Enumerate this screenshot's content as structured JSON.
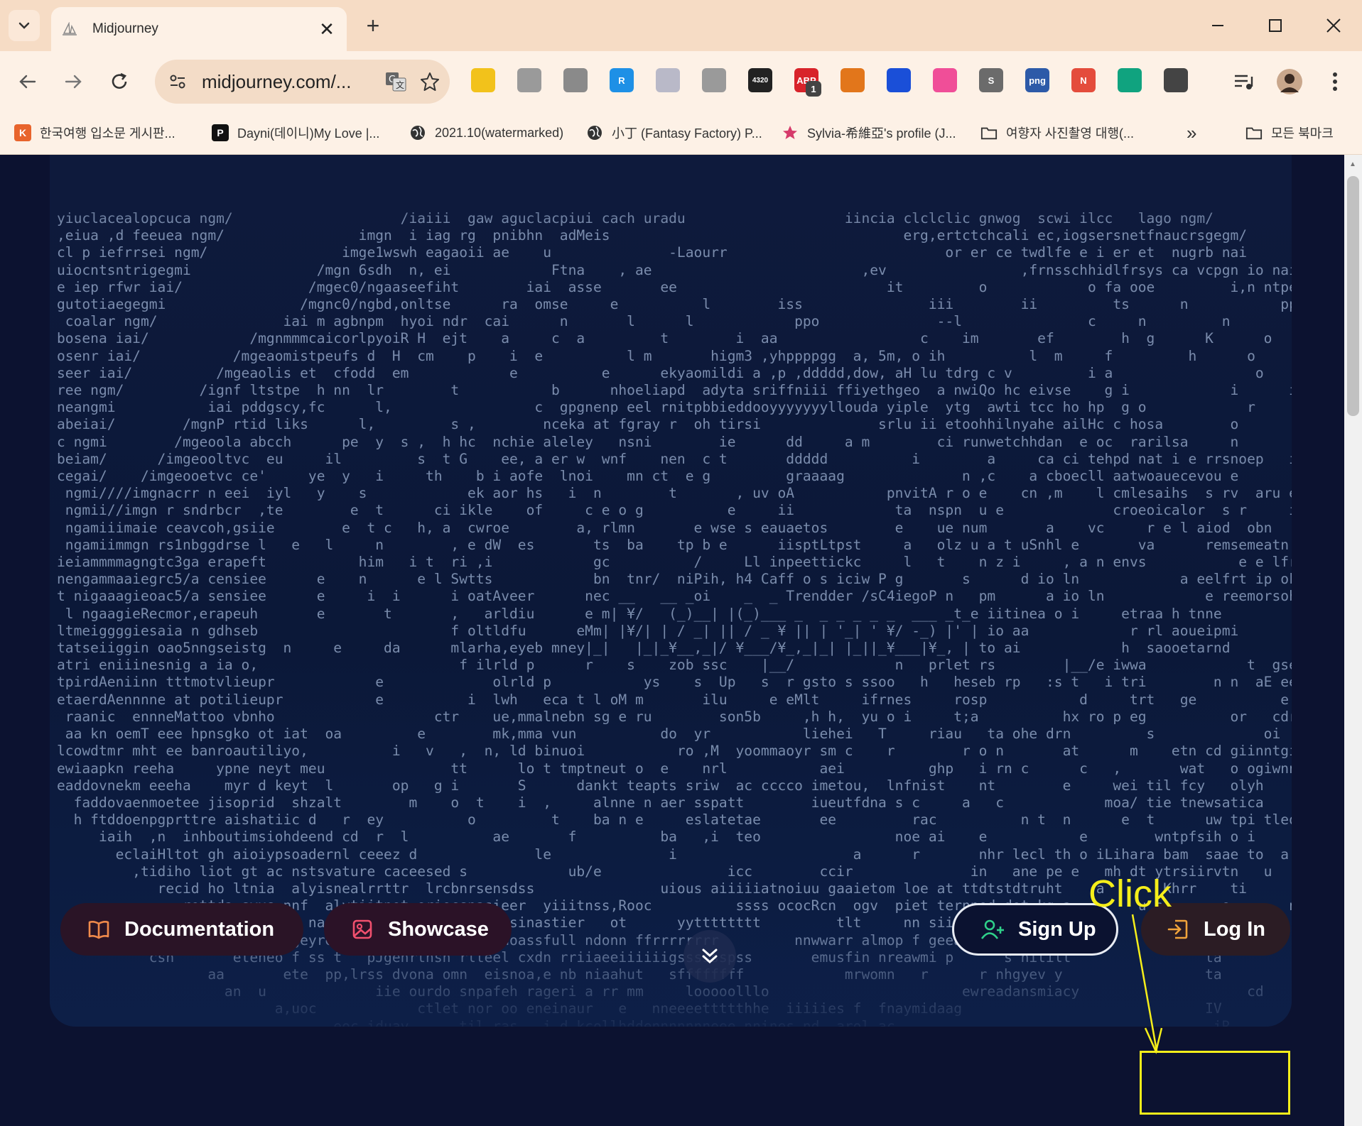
{
  "browser": {
    "tab_title": "Midjourney",
    "tab_close": "✕",
    "new_tab": "+",
    "url": "midjourney.com/...",
    "bookmarks": [
      {
        "label": "한국여행 입소문 게시판...",
        "icon": "K",
        "color": "#e8642c"
      },
      {
        "label": "Dayni(데이니)My Love |...",
        "icon": "P",
        "color": "#111111"
      },
      {
        "label": "2021.10(watermarked)",
        "icon": "globe",
        "color": "#333333"
      },
      {
        "label": "小丁 (Fantasy Factory) P...",
        "icon": "globe",
        "color": "#333333"
      },
      {
        "label": "Sylvia-希維亞's profile (J...",
        "icon": "star",
        "color": "#d63a6a"
      },
      {
        "label": "여향자 사진촬영 대행(...",
        "icon": "folder",
        "color": "#333333"
      }
    ],
    "bookmarks_overflow": "»",
    "all_bookmarks": "모든 북마크",
    "extensions": [
      {
        "name": "yellow-ext-icon",
        "color": "#f2c21b",
        "text": ""
      },
      {
        "name": "camera-ext-icon",
        "color": "#9a9a9a",
        "text": ""
      },
      {
        "name": "download-ext-icon",
        "color": "#8a8a8a",
        "text": ""
      },
      {
        "name": "r-ext-icon",
        "color": "#1e90e6",
        "text": "R"
      },
      {
        "name": "circles-ext-icon",
        "color": "#b9b9c8",
        "text": ""
      },
      {
        "name": "mouse-ext-icon",
        "color": "#9a9a9a",
        "text": ""
      },
      {
        "name": "4320-ext-icon",
        "color": "#222222",
        "text": "4320"
      },
      {
        "name": "abp-ext-icon",
        "color": "#d8232a",
        "text": "ABP"
      },
      {
        "name": "fox-ext-icon",
        "color": "#e2761b",
        "text": ""
      },
      {
        "name": "arrow-down-ext-icon",
        "color": "#1a4fd8",
        "text": ""
      },
      {
        "name": "ring-ext-icon",
        "color": "#f04e98",
        "text": ""
      },
      {
        "name": "s-ext-icon",
        "color": "#6b6b6b",
        "text": "S"
      },
      {
        "name": "png-ext-icon",
        "color": "#2d5aa8",
        "text": "png"
      },
      {
        "name": "n-ext-icon",
        "color": "#e44c3c",
        "text": "N"
      },
      {
        "name": "gpt-ext-icon",
        "color": "#10a37f",
        "text": ""
      },
      {
        "name": "puzzle-ext-icon",
        "color": "#444444",
        "text": ""
      }
    ],
    "abp_badge": "1"
  },
  "page": {
    "ascii_lines": [
      "yiuclacealopcuca ngm/                    /iaiii  gaw aguclacpiui cach uradu                   iincia clclclic gnwog  scwi ilcc   lago ngm/",
      ",eiua ,d feeuea ngm/                imgn  i iag rg  pnibhn  adMeis                                   erg,ertctchcali ec,iogsersnetfnaucrsgegm/",
      "cl p iefrrsei ngm/                imge1wswh eagaoii ae    u              -Laourr                          or er ce twdlfe e i er et  nugrb nai",
      "uiocntsntrigegmi               /mgn 6sdh  n, ei            Ftna    , ae                         ,ev                ,frnsschhidlfrsys ca vcpgn io nai",
      "e iep rfwr iai/               /mgec0/ngaaseefiht        iai  asse       ee                         it         o            o fa ooe         i,n ntpeniioeim/",
      "gutotiaegegmi                /mgnc0/ngbd,onltse      ra  omse     e          l        iss               iii        ii         ts      n           ppsa o           aaocspneoln",
      " coalar ngm/               iai m agbnpm  hyoi ndr  cai      n       l      l            ppo              --l               c     n         n           eotlr                ywelg",
      "bosena iai/            /mgnmmmcaicorlpyoiR H  ejt    a     c  a         t        i  aa                 c    im       ef        h  g      K      o         ne tl                   w",
      "osenr iai/           /mgeaomistpeufs d  H  cm    p    i  e          l m       higm3 ,yhppppgg  a, 5m, o ih          l  m     f         h      o      h        ho c",
      "seer iai/          /mgeaolis et  cfodd  em            e          e      ekyaomildi a ,p ,ddddd,dow, aH lu tdrg c v         i a                 o    r       en",
      "ree ngm/         /ignf ltstpe  h nn  lr        t           b      nhoeliapd  adyta sriffniii ffiyethgeo  a nwiQo hc eivse    g i            i      i     i      e",
      "neangmi           iai pddgscy,fc      l,                 c  gpgnenp eel rnitpbbieddooyyyyyyylloudа yiple  ytg  awti tcc ho hp  g o            r     i     i       st",
      "abeiai/        /mgnP rtid liks      l,         s ,        nceka at fgray r  oh tirsi              srlu ii etoohhilnyahe ailHc c hosa        o                e             re",
      "c ngmi        /mgeoola abcch      pe  y  s ,  h hc  nchie aleley   nsni        ie      dd     a m        ci runwetchhdan  e oc  rarilsa     n           , f              e",
      "beiam/      /imgeooltvc  eu     il         s  t G    ee, a er w  wnf    nen  c t       ddddd          i        a     ca ci tehpd nat i e rrsnoep   i    r    ,       M          e",
      "cegai/    /imgeooetvc ce'     ye  y   i     th    b i aofe  lnoi    mn ct  e g         graaaag              n ,c    a cboecll aatwoauecevou e        r    ,       M   o       e",
      " ngmi////imgnacrr n eei  iyl   y    s            ek aor hs   i  n        t       , uv oA           pnvitA r o e    cn ,m    l cmlesaihs  s rv  aru e       n     ,  l          o      s",
      " ngmii//imgn r sndrbcr  ,te        e  t      ci ikle    of     c e o g          e     ii            ta  nspn  u e             croeoicalor  s r     iisi   n                 r",
      " ngamiiimaie ceavcoh,gsiie        e  t c   h, a  cwroe        a, rlmn       e wse s eauaetos        e    ue num       a    vc     r e l aiod  obn        ,n    t  n    B e          o",
      " ngamiimmgn rs1nbggdrse l   e   l     n        , e dW  es       ts  ba    tp b e      iisptLtpst     a   olz u a t uSnhl e       va      remsemeatn aer      det    s                 i",
      "ieiammmmagngtc3ga erapeft           him   i t  ri ,i            gc          /     Ll inpeettickc     l   t    n z i     , a n envs           e e lfrt ihmmk      isia                  n",
      "nengammaaiegrc5/a censiee      e    n      e l Swtts            bn  tnr/  niPih, h4 Caff o s iciw P g       s      d io ln            a eelfrt ip ok        ista",
      "t nigaaagieoac5/a sensiee      e     i  i      i oatAveer      nec __   __ _oi    _  _ Trendder /sC4iegoP n   pm      a io ln            e reemorsohaeg      etcd   y        a t",
      " l ngaagieRecmor,erapeuh       e       t       ,   arldiu      e m| ¥/   (_)__| |(_)___ _  _ _ _ _ _  ___ _t_e iitinea o i     etraa h tnne         l       e  ,    u i    o",
      "ltmeiggggiesaia n gdhseb                       f oltldfu      eMm| |¥/| | / _| || / _ ¥ || | '_| ' ¥/ -_) |' | io aa            r rl aoueipmi         scn",
      "tatseiiggin oao5nngseistg  n     e     da      mlarha,eyeb mney|_|   |_|_¥__,_|/ ¥___/¥_,_|_| |_||_¥___|¥_, | to ai            h  saooetarnd          a l     ,        t  o    t",
      "atri eniiinesnig a ia o,                        f ilrld p      r    s    zob ssc    |__/            n   prlet rs        |__/e iwwa            t  gseooethra           l bs  e        t  o",
      "tpirdAeniinn tttmotvlieupr            e             olrld p           ys    s  Up   s  r gsto s ssoo   h   heseb rp   :s t   i tri        n n  aE eer oetara           ebs              i  n",
      "etaerdAennnne at potilieupr           e          i  lwh   eca t l oM m       ilu     e eMlt     ifrnes     rosp           d     trt   ge          e yac o pkctcnw          ebu",
      " raanic  ennneMattoo vbnho                   ctr    ue,mmalnebn sg e ru        son5b     ,h h,  yu o i     t;a          hx ro p eg          or   cdr pfwao tt          s an               f s",
      " aa kn oemT eee hpnsgko ot iat  oa         e        mk,mma vun          do  yr           liehei   T     riau   ta ohe drn         s             oi  ne  ci cnca              k     J  i       f s",
      "lcowdtmr mht ee banroautiliyo,          i   v   ,  n, ld binuoi           ro ,M  yoommaoyr sm c    r        r o n       at      m    etn cd giinntgih       n    e n                         s",
      "ewiaapkn reeha     ypne neyt meu               tt      lo t tmptneut o  e    nrl           aei          ghp   i rn c      c   ,       wat   o ogiwnnilrh      ii      e ,      a n             s",
      "eaddovnekm eeeha    myr d keyt  l       op   g i       S      dankt teapts sriw  ac ccccо imetou,  lnfnist    nt        e     wei til fcy   olyh    id        kl               l        n",
      "  faddovaenmoetee jisoprid  shzalt        m    o  t    i  ,     alnne n aer sspatt        iueutfdna s c     a   c            moa/ tie tnewsatica    H,ia     akl     a  m       l",
      "  h ftddoenpgprttre aishatiic d   r  ey          o         t    ba n e     eslatetae       ee         rac          n t  n      e  t      uw tpi tleone  tciltn    iutgr       t,a      a  m                   n",
      "     iaih  ,n  inhboutimsiohdeend cd  r  l          ae       f          ba   ,i  teo                noe ai    e           e        wntpfsih o i     tcibto  uHidnt        rs      n  m                 g",
      "       eclaiHltot gh aioiypsoadernl ceeez d              le              i                     a      r       nhr lecl th o iLihara bam  saae to  a ae         a",
      "         ,tidiho liot gt ac nstsvature caceesed s            ub/e               icc        ccir              in   ane pe e   mh dt ytrsiirvtn   u        ri    n  s    n",
      "            recid ho ltnia  alyisnealrrttr  lrcbnrsensdss               uious aiiiiiatnoiuu gaaietom loe at ttdtstdtruht    a       Khrr    ti      o          s                 d   e",
      "               rettda syxs nnf  alytiitnet oriecsnasieer  yiiitnss,Rooc          ssss ococRcn  ogv  piet ternned det kg a        u s       o       n i                                 e",
      "       e       sre e wr gtsao na sqsel tiiee t    nfacsinastier   ot      yytttttttt         tlt     nn siiioaaflrot snn d        u s         t           s          s                 e     e",
      "    r       tre  o o eoe orJgeyreoi r tut uenedvrosvtdoassfull ndonn ffrrrrrrrr         nnwwarr almop f geeai  pd    ftir                       i       e   c",
      "           csn       eteneo f ss t   pJgenrtnsn rlteel cxdn rriiaeeiiiiiigsssssspss       emusfin nreawmi p      s hitilt                ta                                      t",
      "                  aa       ete  pp,lrss dvona omn  eisnoa,e nb niaahut   sffffffff            mrwomn   r      r nhgyev y                 ta                               a    h",
      "                    an  u             iie ourdo snpafeh rageri a rr mm     looooolllo                       ewreadansmiacy                    cd          n                        i     o",
      "                          a,uoc            ctlet nor oo eneinaur   e   nneeeettttthhe  iiiiies f  fnaymidaag                             IV                                    o",
      "                                 eoc iduay      til ras   i d kcollhddennnnnnneee nnines nd  arol ac                                      iR          i"
    ]
  },
  "buttons": {
    "documentation": "Documentation",
    "showcase": "Showcase",
    "signup": "Sign Up",
    "login": "Log In"
  },
  "annotation": {
    "label": "Click",
    "color": "#f5ee1a"
  }
}
